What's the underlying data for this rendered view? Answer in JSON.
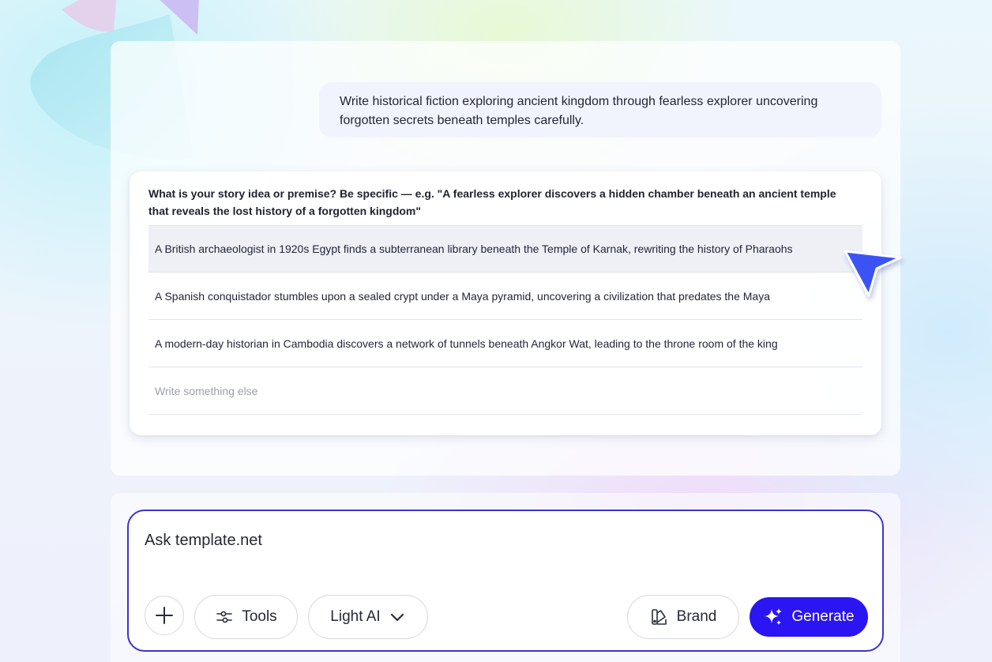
{
  "chat": {
    "user_message": "Write historical fiction exploring ancient kingdom through fearless explorer uncovering forgotten secrets beneath temples carefully."
  },
  "question": {
    "title": "What is your story idea or premise? Be specific — e.g. \"A fearless explorer discovers a hidden chamber beneath an ancient temple that reveals the lost history of a forgotten kingdom\"",
    "options": [
      {
        "label": "A British archaeologist in 1920s Egypt finds a subterranean library beneath the Temple of Karnak, rewriting the history of Pharaohs"
      },
      {
        "label": "A Spanish conquistador stumbles upon a sealed crypt under a Maya pyramid, uncovering a civilization that predates the Maya"
      },
      {
        "label": "A modern-day historian in Cambodia discovers a network of tunnels beneath Angkor Wat, leading to the throne room of the king"
      }
    ],
    "write_else_placeholder": "Write something else"
  },
  "composer": {
    "placeholder": "Ask template.net",
    "tools_label": "Tools",
    "model_label": "Light AI",
    "brand_label": "Brand",
    "generate_label": "Generate"
  },
  "colors": {
    "accent": "#2b15f2",
    "input_border": "#3d33c9",
    "cursor": "#3b52f5"
  }
}
